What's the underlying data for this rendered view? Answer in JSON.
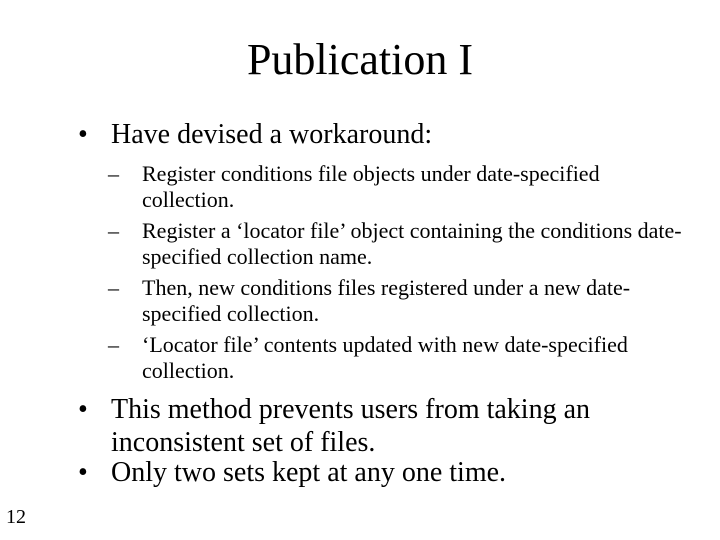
{
  "slide": {
    "title": "Publication I",
    "bullets": [
      {
        "symbol": "•",
        "text": "Have devised a workaround:",
        "sub_items": [
          {
            "symbol": "–",
            "text": "Register conditions file objects under date-specified collection."
          },
          {
            "symbol": "–",
            "text": "Register a ‘locator file’ object containing the conditions date-specified collection name."
          },
          {
            "symbol": "–",
            "text": "Then, new conditions files registered under a new date-specified collection."
          },
          {
            "symbol": "–",
            "text": "‘Locator file’ contents updated with new date-specified collection."
          }
        ]
      },
      {
        "symbol": "•",
        "text": "This method prevents users from taking an inconsistent set of files."
      },
      {
        "symbol": "•",
        "text": "Only two sets kept at any one time."
      }
    ],
    "page_number": "12"
  }
}
